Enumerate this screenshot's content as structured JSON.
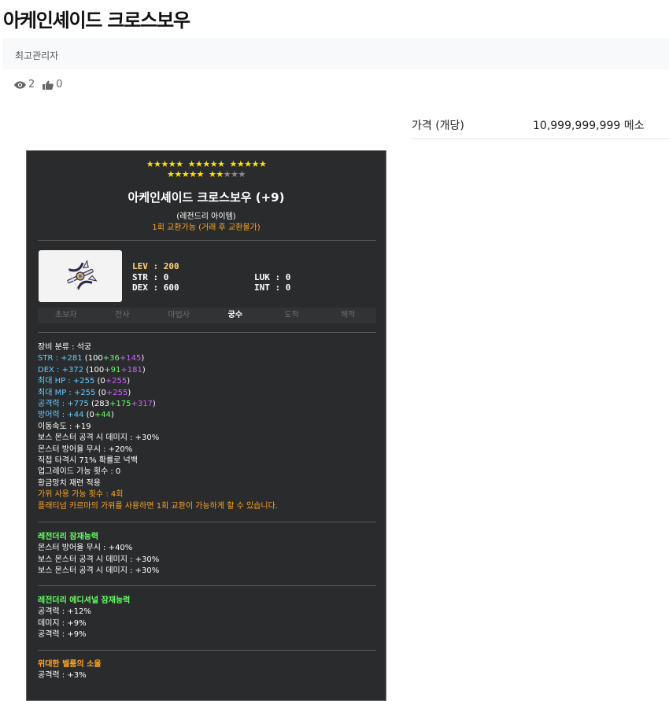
{
  "post": {
    "title": "아케인셰이드 크로스보우",
    "author": "최고관리자",
    "views": "2",
    "likes": "0",
    "price_label": "가격 (개당)",
    "price_value": "10,999,999,999 메소"
  },
  "tooltip": {
    "stars_filled": 22,
    "stars_total": 25,
    "name": "아케인셰이드 크로스보우 (+9)",
    "grade": "(레전드리 아이템)",
    "trade": "1회 교환가능 (거래 후 교환불가)",
    "req": {
      "lev_label": "LEV",
      "lev": "200",
      "str_label": "STR",
      "str": "0",
      "dex_label": "DEX",
      "dex": "600",
      "luk_label": "LUK",
      "luk": "0",
      "int_label": "INT",
      "int": "0"
    },
    "jobs": [
      "초보자",
      "전사",
      "마법사",
      "궁수",
      "도적",
      "해적"
    ],
    "active_job": "궁수",
    "category": "장비 분류 : 석궁",
    "stats": [
      {
        "label": "STR : +281",
        "base": "100",
        "bonus1": "+36",
        "bonus2": "+145"
      },
      {
        "label": "DEX : +372",
        "base": "100",
        "bonus1": "+91",
        "bonus2": "+181"
      },
      {
        "label": "최대 HP : +255",
        "base": "0",
        "bonus1": "",
        "bonus2": "+255"
      },
      {
        "label": "최대 MP : +255",
        "base": "0",
        "bonus1": "",
        "bonus2": "+255"
      },
      {
        "label": "공격력 : +775",
        "base": "283",
        "bonus1": "+175",
        "bonus2": "+317"
      },
      {
        "label": "방어력 : +44",
        "base": "0",
        "bonus1": "+44",
        "bonus2": ""
      }
    ],
    "plain_options": [
      "이동속도 : +19",
      "보스 몬스터 공격 시 데미지 : +30%",
      "몬스터 방어율 무시 : +20%",
      "직접 타격시 71% 확률로 넉백",
      "업그레이드 가능 횟수 : 0",
      "황금망치 재련 적용"
    ],
    "scissors": "가위 사용 가능 횟수 : 4회",
    "karma": "플래티넘 카르마의 가위를 사용하면 1회 교환이 가능하게 할 수 있습니다.",
    "potential_title": "레전더리 잠재능력",
    "potential": [
      "몬스터 방어율 무시 : +40%",
      "보스 몬스터 공격 시 데미지 : +30%",
      "보스 몬스터 공격 시 데미지 : +30%"
    ],
    "additional_title": "레전더리 에디셔널 잠재능력",
    "additional": [
      "공격력 : +12%",
      "데미지 : +9%",
      "공격력 : +9%"
    ],
    "soul_title": "위대한 벨룸의 소울",
    "soul": [
      "공격력 : +3%"
    ],
    "colors": {
      "background": "#2a2b2d",
      "star": "#ffe400",
      "orange": "#ffa626",
      "blue": "#66ccff",
      "green": "#66ff66",
      "purple": "#cc66ff"
    }
  }
}
